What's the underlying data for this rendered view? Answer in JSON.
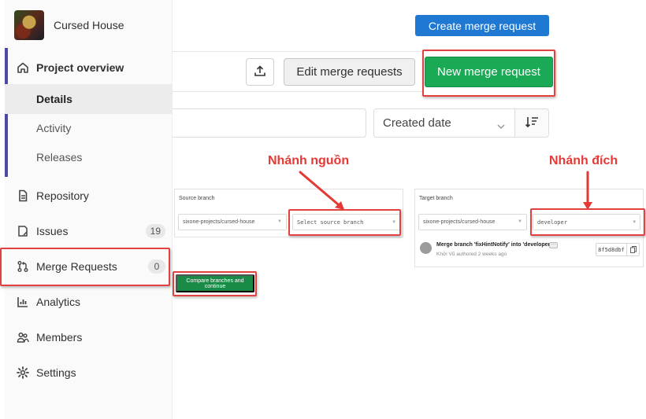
{
  "project": {
    "name": "Cursed House"
  },
  "sidebar": {
    "project_overview": "Project overview",
    "sub_items": [
      {
        "label": "Details",
        "active": true
      },
      {
        "label": "Activity",
        "active": false
      },
      {
        "label": "Releases",
        "active": false
      }
    ],
    "items": [
      {
        "label": "Repository",
        "icon": "document-icon"
      },
      {
        "label": "Issues",
        "icon": "issues-icon",
        "badge": "19"
      },
      {
        "label": "Merge Requests",
        "icon": "merge-request-icon",
        "badge": "0"
      },
      {
        "label": "Analytics",
        "icon": "chart-icon"
      },
      {
        "label": "Members",
        "icon": "users-icon"
      },
      {
        "label": "Settings",
        "icon": "gear-icon"
      }
    ]
  },
  "header": {
    "create_merge_request": "Create merge request",
    "edit_merge_requests": "Edit merge requests",
    "new_merge_request": "New merge request"
  },
  "filter": {
    "search_value": "",
    "sort_label": "Created date"
  },
  "annotations": {
    "source_label": "Nhánh nguồn",
    "target_label": "Nhánh đích",
    "highlight_color": "#e34040"
  },
  "source_panel": {
    "title": "Source branch",
    "project": "sixone-projects/cursed-house",
    "branch_placeholder": "Select source branch"
  },
  "target_panel": {
    "title": "Target branch",
    "project": "sixone-projects/cursed-house",
    "branch": "developer",
    "commit": {
      "title": "Merge branch 'fixHintNotify' into 'developer'",
      "author": "Khởi Vũ",
      "meta_suffix": "authored 2 weeks ago",
      "sha": "8f5d8dbf"
    }
  },
  "compare_button": "Compare branches and continue",
  "colors": {
    "primary_blue": "#1f78d1",
    "success_green": "#1aaa55",
    "sidebar_accent": "#4b4ba3"
  }
}
